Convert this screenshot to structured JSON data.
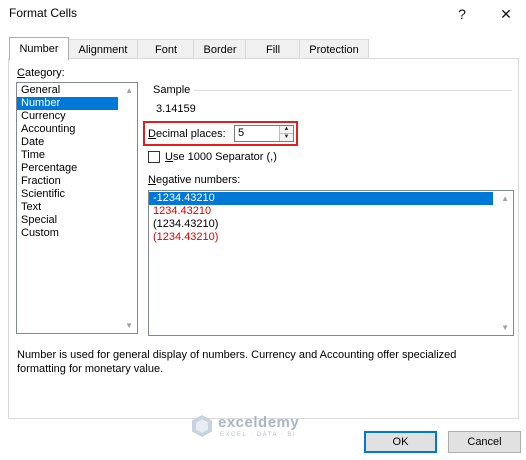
{
  "dialog": {
    "title": "Format Cells",
    "help_glyph": "?",
    "close_glyph": "✕"
  },
  "tabs": [
    {
      "label": "Number",
      "active": true
    },
    {
      "label": "Alignment"
    },
    {
      "label": "Font"
    },
    {
      "label": "Border"
    },
    {
      "label": "Fill"
    },
    {
      "label": "Protection"
    }
  ],
  "category": {
    "label_first": "C",
    "label_rest": "ategory:",
    "items": [
      "General",
      "Number",
      "Currency",
      "Accounting",
      "Date",
      "Time",
      "Percentage",
      "Fraction",
      "Scientific",
      "Text",
      "Special",
      "Custom"
    ],
    "selected": "Number"
  },
  "sample": {
    "label": "Sample",
    "value": "3.14159"
  },
  "decimal_places": {
    "label_first": "D",
    "label_rest": "ecimal places:",
    "value": "5",
    "highlight_color": "#e02020"
  },
  "separator": {
    "label_first": "U",
    "label_rest": "se 1000 Separator (,)",
    "checked": false
  },
  "negative_numbers": {
    "label_first": "N",
    "label_rest": "egative numbers:",
    "items": [
      {
        "text": "-1234.43210",
        "color": "black",
        "selected": true
      },
      {
        "text": "1234.43210",
        "color": "red"
      },
      {
        "text": "(1234.43210)",
        "color": "black"
      },
      {
        "text": "(1234.43210)",
        "color": "red"
      }
    ]
  },
  "description": "Number is used for general display of numbers.  Currency and Accounting offer specialized formatting for monetary value.",
  "watermark": {
    "name": "exceldemy",
    "tagline": "EXCEL · DATA · BI"
  },
  "buttons": {
    "ok": "OK",
    "cancel": "Cancel"
  },
  "colors": {
    "accent": "#0078d7",
    "negative_red": "#e00000"
  }
}
